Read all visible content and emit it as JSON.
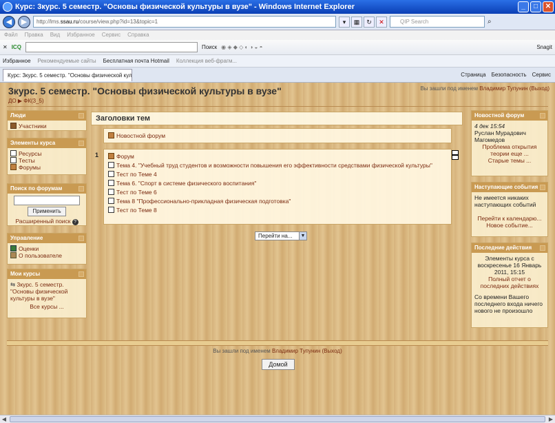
{
  "window": {
    "title": "Курс: 3курс. 5 семестр. \"Основы физической культуры в вузе\" - Windows Internet Explorer",
    "url_prefix": "http://lms.",
    "url_domain": "ssau.ru",
    "url_path": "/course/view.php?id=13&topic=1",
    "search_placeholder": "QIP Search",
    "menu": [
      "Файл",
      "Правка",
      "Вид",
      "Избранное",
      "Сервис",
      "Справка"
    ],
    "toolbar_icq": "ICQ",
    "toolbar_search": "Поиск",
    "toolbar_snagit": "Snagit",
    "fav_label": "Избранное",
    "fav_items": [
      "Рекомендуемые сайты",
      "Бесплатная почта Hotmail",
      "Коллекция веб-фрагм..."
    ],
    "tab_label": "Курс: 3курс. 5 семестр. \"Основы физической культ...",
    "tab_right": [
      "Страница",
      "Безопасность",
      "Сервис"
    ]
  },
  "page": {
    "course_title": "3курс. 5 семестр. \"Основы физической культуры в вузе\"",
    "logged_prefix": "Вы зашли под именем",
    "user_name": "Владимир Тупунин",
    "logout": "(Выход)",
    "breadcrumb": "ДО ▶ ФК(3_5)"
  },
  "left": {
    "people_title": "Люди",
    "participants": "Участники",
    "elements_title": "Элементы курса",
    "elements": [
      "Ресурсы",
      "Тесты",
      "Форумы"
    ],
    "search_title": "Поиск по форумам",
    "apply": "Применить",
    "advanced": "Расширенный поиск",
    "manage_title": "Управление",
    "grades": "Оценки",
    "about_user": "О пользователе",
    "mycourses_title": "Мои курсы",
    "mycourse": "3курс. 5 семестр. \"Основы физической культуры в вузе\"",
    "all_courses": "Все курсы ..."
  },
  "center": {
    "heading": "Заголовки тем",
    "news_forum": "Новостной форум",
    "section_num": "1",
    "items": [
      {
        "icon": "forum",
        "label": "Форум"
      },
      {
        "icon": "res",
        "label": "Тема 4. \"Учебный труд студентов и возможности повышения его эффективности средствами физической культуры\""
      },
      {
        "icon": "test",
        "label": "Тест по Теме 4"
      },
      {
        "icon": "res",
        "label": "Тема 6. \"Спорт в системе физического воспитания\""
      },
      {
        "icon": "test",
        "label": "Тест по Теме 6"
      },
      {
        "icon": "res",
        "label": "Тема 8 \"Профессионально-прикладная физическая подготовка\""
      },
      {
        "icon": "test",
        "label": "Тест по Теме 8"
      }
    ],
    "jump": "Перейти на..."
  },
  "right": {
    "news_title": "Новостной форум",
    "news_date": "4 дек 15:54",
    "news_author": "Руслан Мурадович Магомедов",
    "news_topic": "Проблема открытия теории еще ...",
    "old_topics": "Старые темы ...",
    "events_title": "Наступающие события",
    "no_events": "Не имеется никаких наступающих событий",
    "to_calendar": "Перейти к календарю...",
    "new_event": "Новое событие...",
    "recent_title": "Последние действия",
    "recent_since": "Элементы курса с воскресенье 16 Январь 2011, 15:15",
    "full_report": "Полный отчет о последних действиях",
    "nothing_new": "Со времени Вашего последнего входа ничего нового не произошло"
  },
  "footer": {
    "logged_prefix": "Вы зашли под именем",
    "user_name": "Владимир Тупунин",
    "logout": "(Выход)",
    "home": "Домой"
  }
}
